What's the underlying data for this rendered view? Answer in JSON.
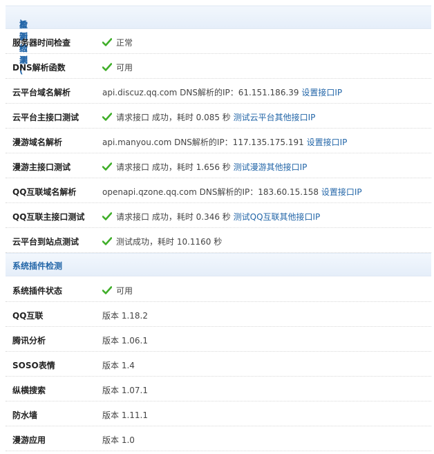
{
  "section1": {
    "title": "检测结果(",
    "recheck": "重新检测",
    "title_end": ")",
    "rows": [
      {
        "label": "服务器时间检查",
        "ok": true,
        "text": "正常",
        "link": ""
      },
      {
        "label": "DNS解析函数",
        "ok": true,
        "text": "可用",
        "link": ""
      },
      {
        "label": "云平台域名解析",
        "ok": false,
        "text": "api.discuz.qq.com DNS解析的IP：61.151.186.39 ",
        "link": "设置接口IP"
      },
      {
        "label": "云平台主接口测试",
        "ok": true,
        "text": "请求接口 成功，耗时 0.085 秒 ",
        "link": "测试云平台其他接口IP"
      },
      {
        "label": "漫游域名解析",
        "ok": false,
        "text": "api.manyou.com DNS解析的IP：117.135.175.191 ",
        "link": "设置接口IP"
      },
      {
        "label": "漫游主接口测试",
        "ok": true,
        "text": "请求接口 成功，耗时 1.656 秒 ",
        "link": "测试漫游其他接口IP"
      },
      {
        "label": "QQ互联域名解析",
        "ok": false,
        "text": "openapi.qzone.qq.com DNS解析的IP：183.60.15.158 ",
        "link": "设置接口IP"
      },
      {
        "label": "QQ互联主接口测试",
        "ok": true,
        "text": "请求接口 成功，耗时 0.346 秒 ",
        "link": "测试QQ互联其他接口IP"
      },
      {
        "label": "云平台到站点测试",
        "ok": true,
        "text": "测试成功，耗时 10.1160 秒",
        "link": ""
      }
    ]
  },
  "section2": {
    "title": "系统插件检测",
    "rows": [
      {
        "label": "系统插件状态",
        "ok": true,
        "text": "可用"
      },
      {
        "label": "QQ互联",
        "ok": false,
        "text": "版本 1.18.2"
      },
      {
        "label": "腾讯分析",
        "ok": false,
        "text": "版本 1.06.1"
      },
      {
        "label": "SOSO表情",
        "ok": false,
        "text": "版本 1.4"
      },
      {
        "label": "纵横搜索",
        "ok": false,
        "text": "版本 1.07.1"
      },
      {
        "label": "防水墙",
        "ok": false,
        "text": "版本 1.11.1"
      },
      {
        "label": "漫游应用",
        "ok": false,
        "text": "版本 1.0"
      }
    ]
  },
  "colors": {
    "accent": "#2366a8",
    "check": "#3fae29",
    "header_bg": "#e9f1fb"
  },
  "icons": {
    "ok": "check-icon"
  }
}
